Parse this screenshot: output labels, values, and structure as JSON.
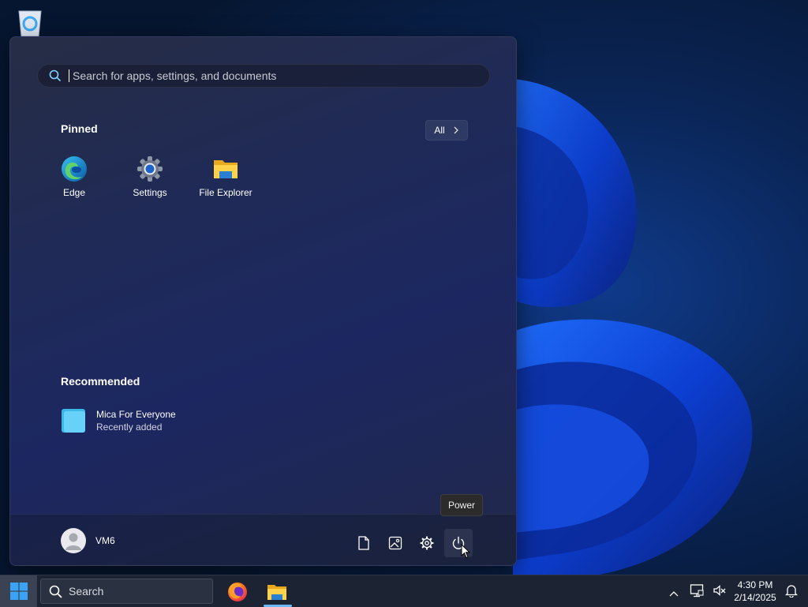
{
  "start_menu": {
    "search": {
      "placeholder": "Search for apps, settings, and documents"
    },
    "pinned": {
      "title": "Pinned",
      "all_label": "All",
      "apps": [
        {
          "label": "Edge",
          "icon": "edge-icon"
        },
        {
          "label": "Settings",
          "icon": "settings-gear-icon"
        },
        {
          "label": "File Explorer",
          "icon": "folder-icon"
        }
      ]
    },
    "recommended": {
      "title": "Recommended",
      "items": [
        {
          "title": "Mica For Everyone",
          "subtitle": "Recently added",
          "icon": "mica-app-icon"
        }
      ]
    },
    "footer": {
      "user_name": "VM6",
      "buttons": [
        "documents-icon",
        "pictures-icon",
        "settings-icon",
        "power-icon"
      ],
      "tooltip": "Power"
    }
  },
  "taskbar": {
    "search_label": "Search",
    "apps": [
      "firefox-icon",
      "file-explorer-icon"
    ],
    "clock": {
      "time": "4:30 PM",
      "date": "2/14/2025"
    },
    "tray": [
      "chevron-up-icon",
      "network-icon",
      "volume-muted-icon",
      "notification-bell-icon"
    ]
  },
  "colors": {
    "accent": "#6cb8f6",
    "desktop": "#081a3c",
    "taskbar": "#1c2433"
  }
}
